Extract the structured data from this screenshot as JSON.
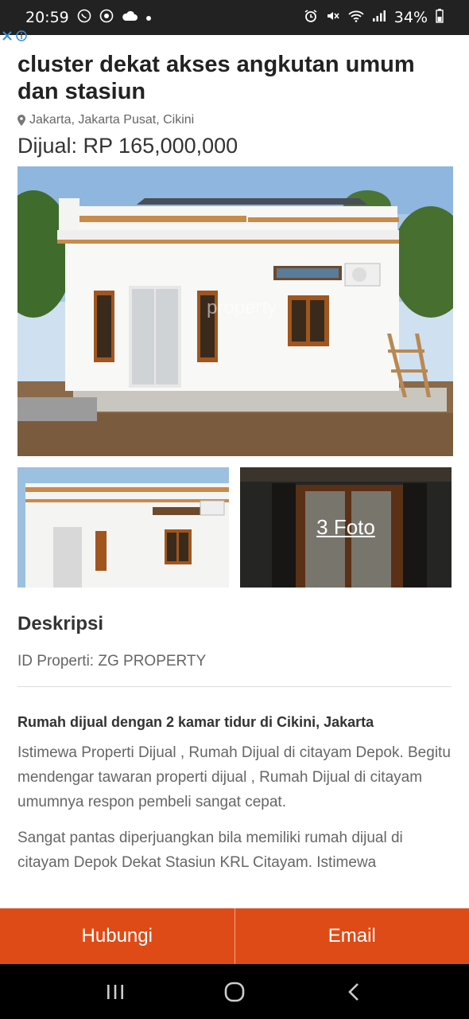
{
  "status_bar": {
    "time": "20:59",
    "battery": "34%",
    "icons": [
      "whatsapp-icon",
      "chrome-icon",
      "cloud-icon",
      "dot-icon",
      "alarm-icon",
      "mute-icon",
      "wifi-icon",
      "signal-icon",
      "battery-icon"
    ]
  },
  "listing": {
    "title": "cluster dekat akses angkutan umum dan stasiun",
    "location": "Jakarta, Jakarta Pusat, Cikini",
    "price": "Dijual: RP 165,000,000",
    "watermark": "property",
    "photos_count_label": "3 Foto"
  },
  "description": {
    "section_title": "Deskripsi",
    "property_id": "ID Properti: ZG PROPERTY",
    "heading": "Rumah dijual dengan 2 kamar tidur di Cikini, Jakarta",
    "paragraph1": "Istimewa Properti Dijual , Rumah Dijual di citayam Depok. Begitu mendengar tawaran properti dijual , Rumah Dijual di citayam umumnya respon pembeli sangat cepat.",
    "paragraph2": "Sangat pantas diperjuangkan bila memiliki rumah dijual di citayam Depok Dekat Stasiun KRL Citayam. Istimewa"
  },
  "cta": {
    "contact_label": "Hubungi",
    "email_label": "Email",
    "color": "#df4b16"
  },
  "nav": {
    "icons": [
      "recent-apps-icon",
      "home-icon",
      "back-icon"
    ]
  }
}
